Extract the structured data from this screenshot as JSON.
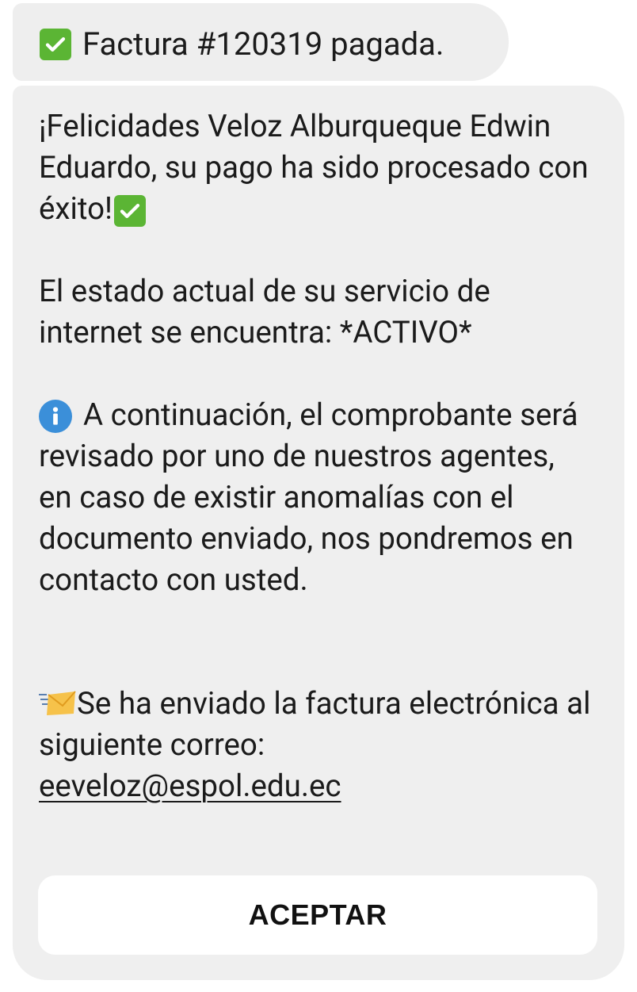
{
  "header": {
    "title": "Factura #120319 pagada.",
    "icon": "check-mark-button-icon"
  },
  "message": {
    "congrats": "¡Felicidades Veloz Alburqueque Edwin Eduardo, su pago ha sido procesado con éxito!",
    "status": "El estado actual de su servicio de internet se encuentra: *ACTIVO*",
    "review_text": "A continuación, el comprobante será revisado por uno de nuestros agentes, en caso de existir anomalías con el documento enviado, nos pondremos en contacto con usted.",
    "invoice_sent": "Se ha enviado la factura electrónica al siguiente correo:",
    "email": "eeveloz@espol.edu.ec"
  },
  "button": {
    "label": "ACEPTAR"
  },
  "colors": {
    "bubble": "#efefef",
    "check": "#5bb534",
    "info": "#3b8fd9",
    "button": "#ffffff"
  }
}
